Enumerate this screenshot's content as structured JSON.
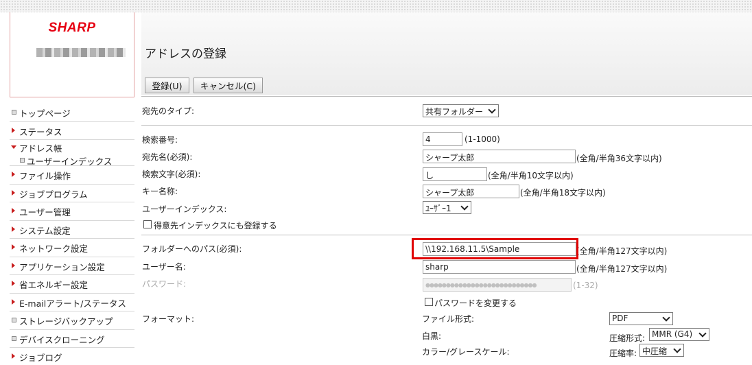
{
  "brand": {
    "logo": "SHARP"
  },
  "sidebar": {
    "items": [
      {
        "label": "トップページ",
        "icon": "square-bullet-icon"
      },
      {
        "label": "ステータス",
        "icon": "triangle-right-icon"
      },
      {
        "label": "アドレス帳",
        "icon": "triangle-down-icon"
      },
      {
        "label": "ユーザーインデックス",
        "icon": "square-bullet-icon",
        "sub": true
      },
      {
        "label": "ファイル操作",
        "icon": "triangle-right-icon"
      },
      {
        "label": "ジョブプログラム",
        "icon": "triangle-right-icon"
      },
      {
        "label": "ユーザー管理",
        "icon": "triangle-right-icon"
      },
      {
        "label": "システム設定",
        "icon": "triangle-right-icon"
      },
      {
        "label": "ネットワーク設定",
        "icon": "triangle-right-icon"
      },
      {
        "label": "アプリケーション設定",
        "icon": "triangle-right-icon"
      },
      {
        "label": "省エネルギー設定",
        "icon": "triangle-right-icon"
      },
      {
        "label": "E-mailアラート/ステータス",
        "icon": "triangle-right-icon"
      },
      {
        "label": "ストレージバックアップ",
        "icon": "square-bullet-icon"
      },
      {
        "label": "デバイスクローニング",
        "icon": "square-bullet-icon"
      },
      {
        "label": "ジョブログ",
        "icon": "triangle-right-icon"
      }
    ]
  },
  "page": {
    "title": "アドレスの登録"
  },
  "toolbar": {
    "register_label": "登録(U)",
    "cancel_label": "キャンセル(C)"
  },
  "form": {
    "dest_type": {
      "label": "宛先のタイプ:",
      "value": "共有フォルダー"
    },
    "search_no": {
      "label": "検索番号:",
      "value": "4",
      "hint": "(1-1000)"
    },
    "dest_name": {
      "label": "宛先名(必須):",
      "value": "シャープ太郎",
      "hint": "(全角/半角36文字以内)"
    },
    "search_char": {
      "label": "検索文字(必須):",
      "value": "し",
      "hint": "(全角/半角10文字以内)"
    },
    "key_name": {
      "label": "キー名称:",
      "value": "シャープ太郎",
      "hint": "(全角/半角18文字以内)"
    },
    "user_index": {
      "label": "ユーザーインデックス:",
      "value": "ﾕｰｻﾞｰ1"
    },
    "favorite": {
      "label": "得意先インデックスにも登録する"
    },
    "folder_path": {
      "label": "フォルダーへのパス(必須):",
      "value": "\\\\192.168.11.5\\Sample",
      "hint": "(全角/半角127文字以内)"
    },
    "user_name": {
      "label": "ユーザー名:",
      "value": "sharp",
      "hint": "(全角/半角127文字以内)"
    },
    "password": {
      "label": "パスワード:",
      "value": "●●●●●●●●●●●●●●●●●●●●●●●●●●●",
      "hint": "(1-32)"
    },
    "change_password": {
      "label": "パスワードを変更する"
    },
    "format": {
      "label": "フォーマット:",
      "file_type_label": "ファイル形式:",
      "file_type_value": "PDF",
      "mono_label": "白黒:",
      "mono_comp_label": "圧縮形式:",
      "mono_comp_value": "MMR (G4)",
      "color_label": "カラー/グレースケール:",
      "color_comp_label": "圧縮率:",
      "color_comp_value": "中圧縮"
    }
  },
  "colors": {
    "accent": "#e60012",
    "highlight": "#e00000"
  }
}
